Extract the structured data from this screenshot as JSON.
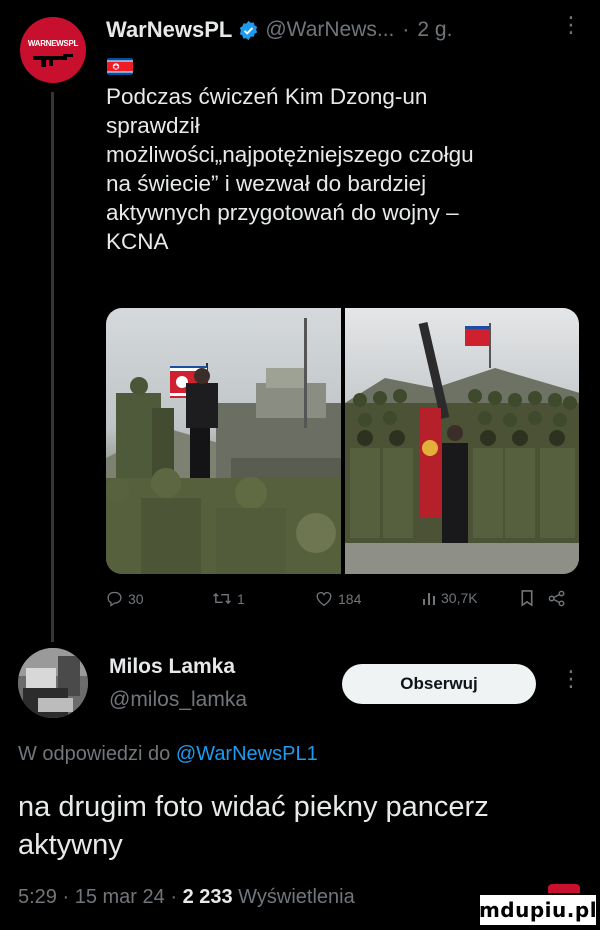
{
  "tweet": {
    "avatar_text": "WARNEWSPL",
    "author_name": "WarNewsPL",
    "handle": "@WarNews...",
    "separator": "·",
    "time": "2 g.",
    "more": "⋮",
    "text": "Podczas ćwiczeń Kim Dzong-un\nsprawdził\nmożliwości„najpotężniejszego czołgu\nna świecie” i wezwał do bardziej\naktywnych przygotowań do wojny –\nKCNA",
    "stats": {
      "replies": "30",
      "retweets": "1",
      "likes": "184",
      "views": "30,7K"
    }
  },
  "reply": {
    "author_name": "Milos Lamka",
    "handle": "@milos_lamka",
    "follow_label": "Obserwuj",
    "more": "⋮",
    "reply_prefix": "W odpowiedzi do ",
    "reply_mention": "@WarNewsPL1",
    "text": "na drugim foto widać piekny pancerz aktywny",
    "time": "5:29",
    "sep1": " · ",
    "date": "15 mar 24",
    "sep2": " · ",
    "views_count": "2 233",
    "views_label": " Wyświetlenia"
  },
  "watermark": "mdupiu.pl",
  "colors": {
    "background": "#000000",
    "text": "#e7e9ea",
    "secondary": "#71767b",
    "link": "#1d9bf0",
    "verified": "#1d9bf0",
    "button_bg": "#eff3f4",
    "brand_red": "#c8102e"
  },
  "icons": [
    "verified-badge-icon",
    "reply-icon",
    "retweet-icon",
    "like-icon",
    "views-icon",
    "bookmark-icon",
    "share-icon",
    "more-icon"
  ]
}
